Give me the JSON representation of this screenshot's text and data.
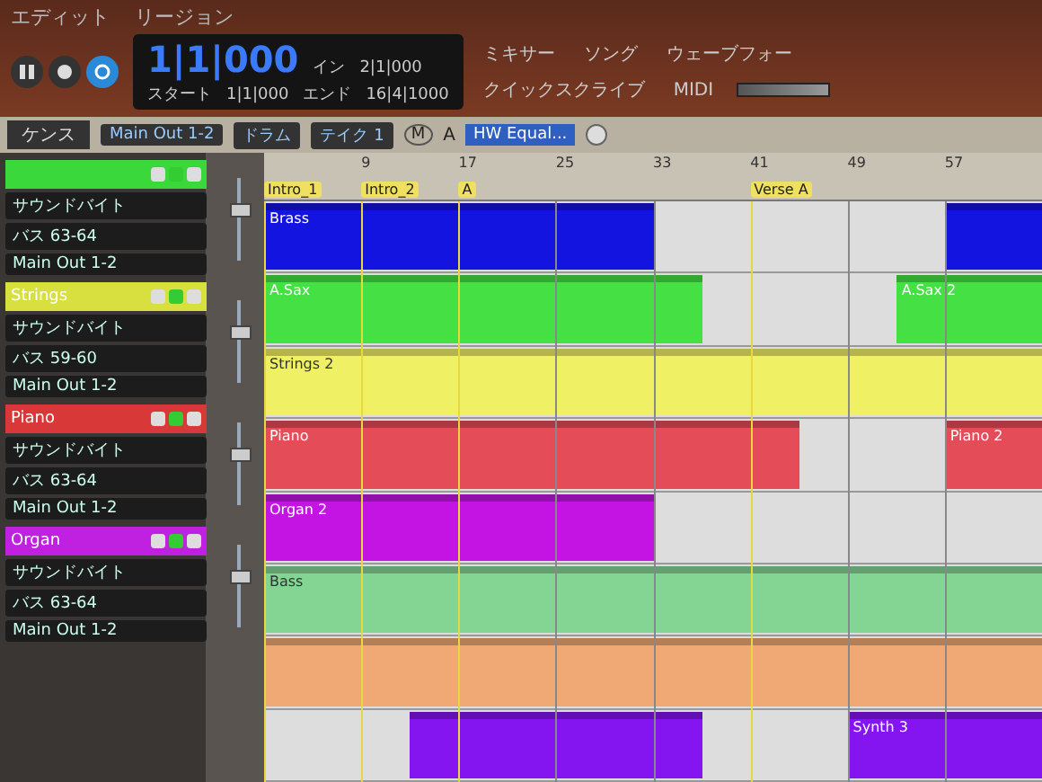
{
  "menu": [
    "エディット",
    "リージョン"
  ],
  "transport": {
    "time": "1|1|000",
    "start_label": "スタート",
    "start": "1|1|000",
    "end_label": "エンド",
    "end": "16|4|1000",
    "in_label": "イン",
    "in": "2|1|000"
  },
  "view_tabs": [
    {
      "label": "ミキサー",
      "selected": false
    },
    {
      "label": "ソング",
      "selected": false
    },
    {
      "label": "ウェーブフォー",
      "selected": false
    }
  ],
  "quickscribe": "クイックスクライブ",
  "midi": "MIDI",
  "toolbar": {
    "category": "ドラム",
    "take": "テイク 1",
    "tab": "ケンス",
    "output": "Main Out 1-2",
    "m": "M",
    "a": "A",
    "plugin": "HW Equal..."
  },
  "ruler": [
    {
      "marker": "Intro_1"
    },
    {
      "number": "9",
      "marker": "Intro_2"
    },
    {
      "number": "17",
      "marker": "A"
    },
    {
      "number": "25"
    },
    {
      "number": "33"
    },
    {
      "number": "41",
      "marker": "Verse A"
    },
    {
      "number": "49"
    },
    {
      "number": "57"
    }
  ],
  "channels": [
    {
      "color": "#3ad83a",
      "level": 0.6,
      "rows": [
        "サウンドバイト",
        "バス 63-64",
        "Main Out 1-2"
      ]
    },
    {
      "name": "Strings",
      "color": "#d8e040",
      "level": 0.6,
      "rows": [
        "サウンドバイト",
        "バス 59-60",
        "Main Out 1-2"
      ]
    },
    {
      "name": "Piano",
      "color": "#d83838",
      "level": 0.6,
      "rows": [
        "サウンドバイト",
        "バス 63-64",
        "Main Out 1-2"
      ]
    },
    {
      "name": "Organ",
      "color": "#c020e0",
      "level": 0.6,
      "rows": [
        "サウンドバイト",
        "バス 63-64",
        "Main Out 1-2"
      ]
    }
  ],
  "lanes": [
    {
      "regions": [
        {
          "name": "Brass",
          "color": "#1414e0"
        },
        {
          "color": "#1414e0"
        }
      ]
    },
    {
      "regions": [
        {
          "name": "A.Sax",
          "color": "#44e044"
        },
        {
          "name": "A.Sax 2",
          "color": "#44e044"
        }
      ]
    },
    {
      "regions": [
        {
          "name": "Strings 2",
          "color": "#f0f064"
        }
      ]
    },
    {
      "regions": [
        {
          "name": "Piano",
          "color": "#e44c58"
        },
        {
          "name": "Piano 2",
          "color": "#e44c58"
        }
      ]
    },
    {
      "regions": [
        {
          "name": "Organ 2",
          "color": "#c414e4"
        }
      ]
    },
    {
      "regions": [
        {
          "name": "Bass",
          "color": "#84d494"
        }
      ]
    },
    {
      "regions": [
        {
          "color": "#f0a874"
        }
      ]
    },
    {
      "regions": [
        {
          "color": "#8414f0"
        },
        {
          "name": "Synth 3",
          "color": "#8414f0"
        }
      ]
    }
  ]
}
